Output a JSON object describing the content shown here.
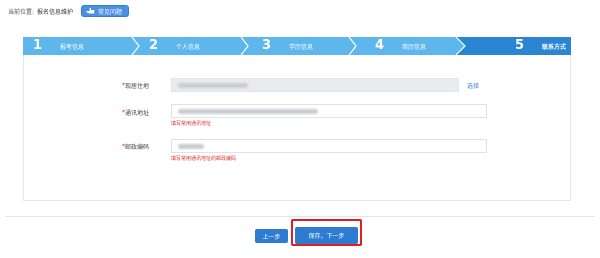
{
  "breadcrumb": {
    "label": "当前位置:",
    "current": "报名信息维护",
    "faq_label": "常见问题"
  },
  "steps": [
    {
      "num": "1",
      "label": "报考信息"
    },
    {
      "num": "2",
      "label": "个人信息"
    },
    {
      "num": "3",
      "label": "学历信息"
    },
    {
      "num": "4",
      "label": "简历信息"
    },
    {
      "num": "5",
      "label": "联系方式"
    }
  ],
  "form": {
    "residence": {
      "required": "*",
      "label": "现居住地",
      "action": "选择"
    },
    "address": {
      "required": "*",
      "label": "通讯地址",
      "hint": "填写常用通讯地址"
    },
    "postcode": {
      "required": "*",
      "label": "邮政编码",
      "hint": "填写常用通讯地址的邮政编码"
    }
  },
  "buttons": {
    "prev": "上一步",
    "next": "保存，下一步"
  },
  "colors": {
    "step_blue": "#5db6ec",
    "step_active": "#2a86d2",
    "required": "#e02020",
    "hint": "#e0302c",
    "button": "#2e7cd1",
    "highlight": "#e02020"
  }
}
